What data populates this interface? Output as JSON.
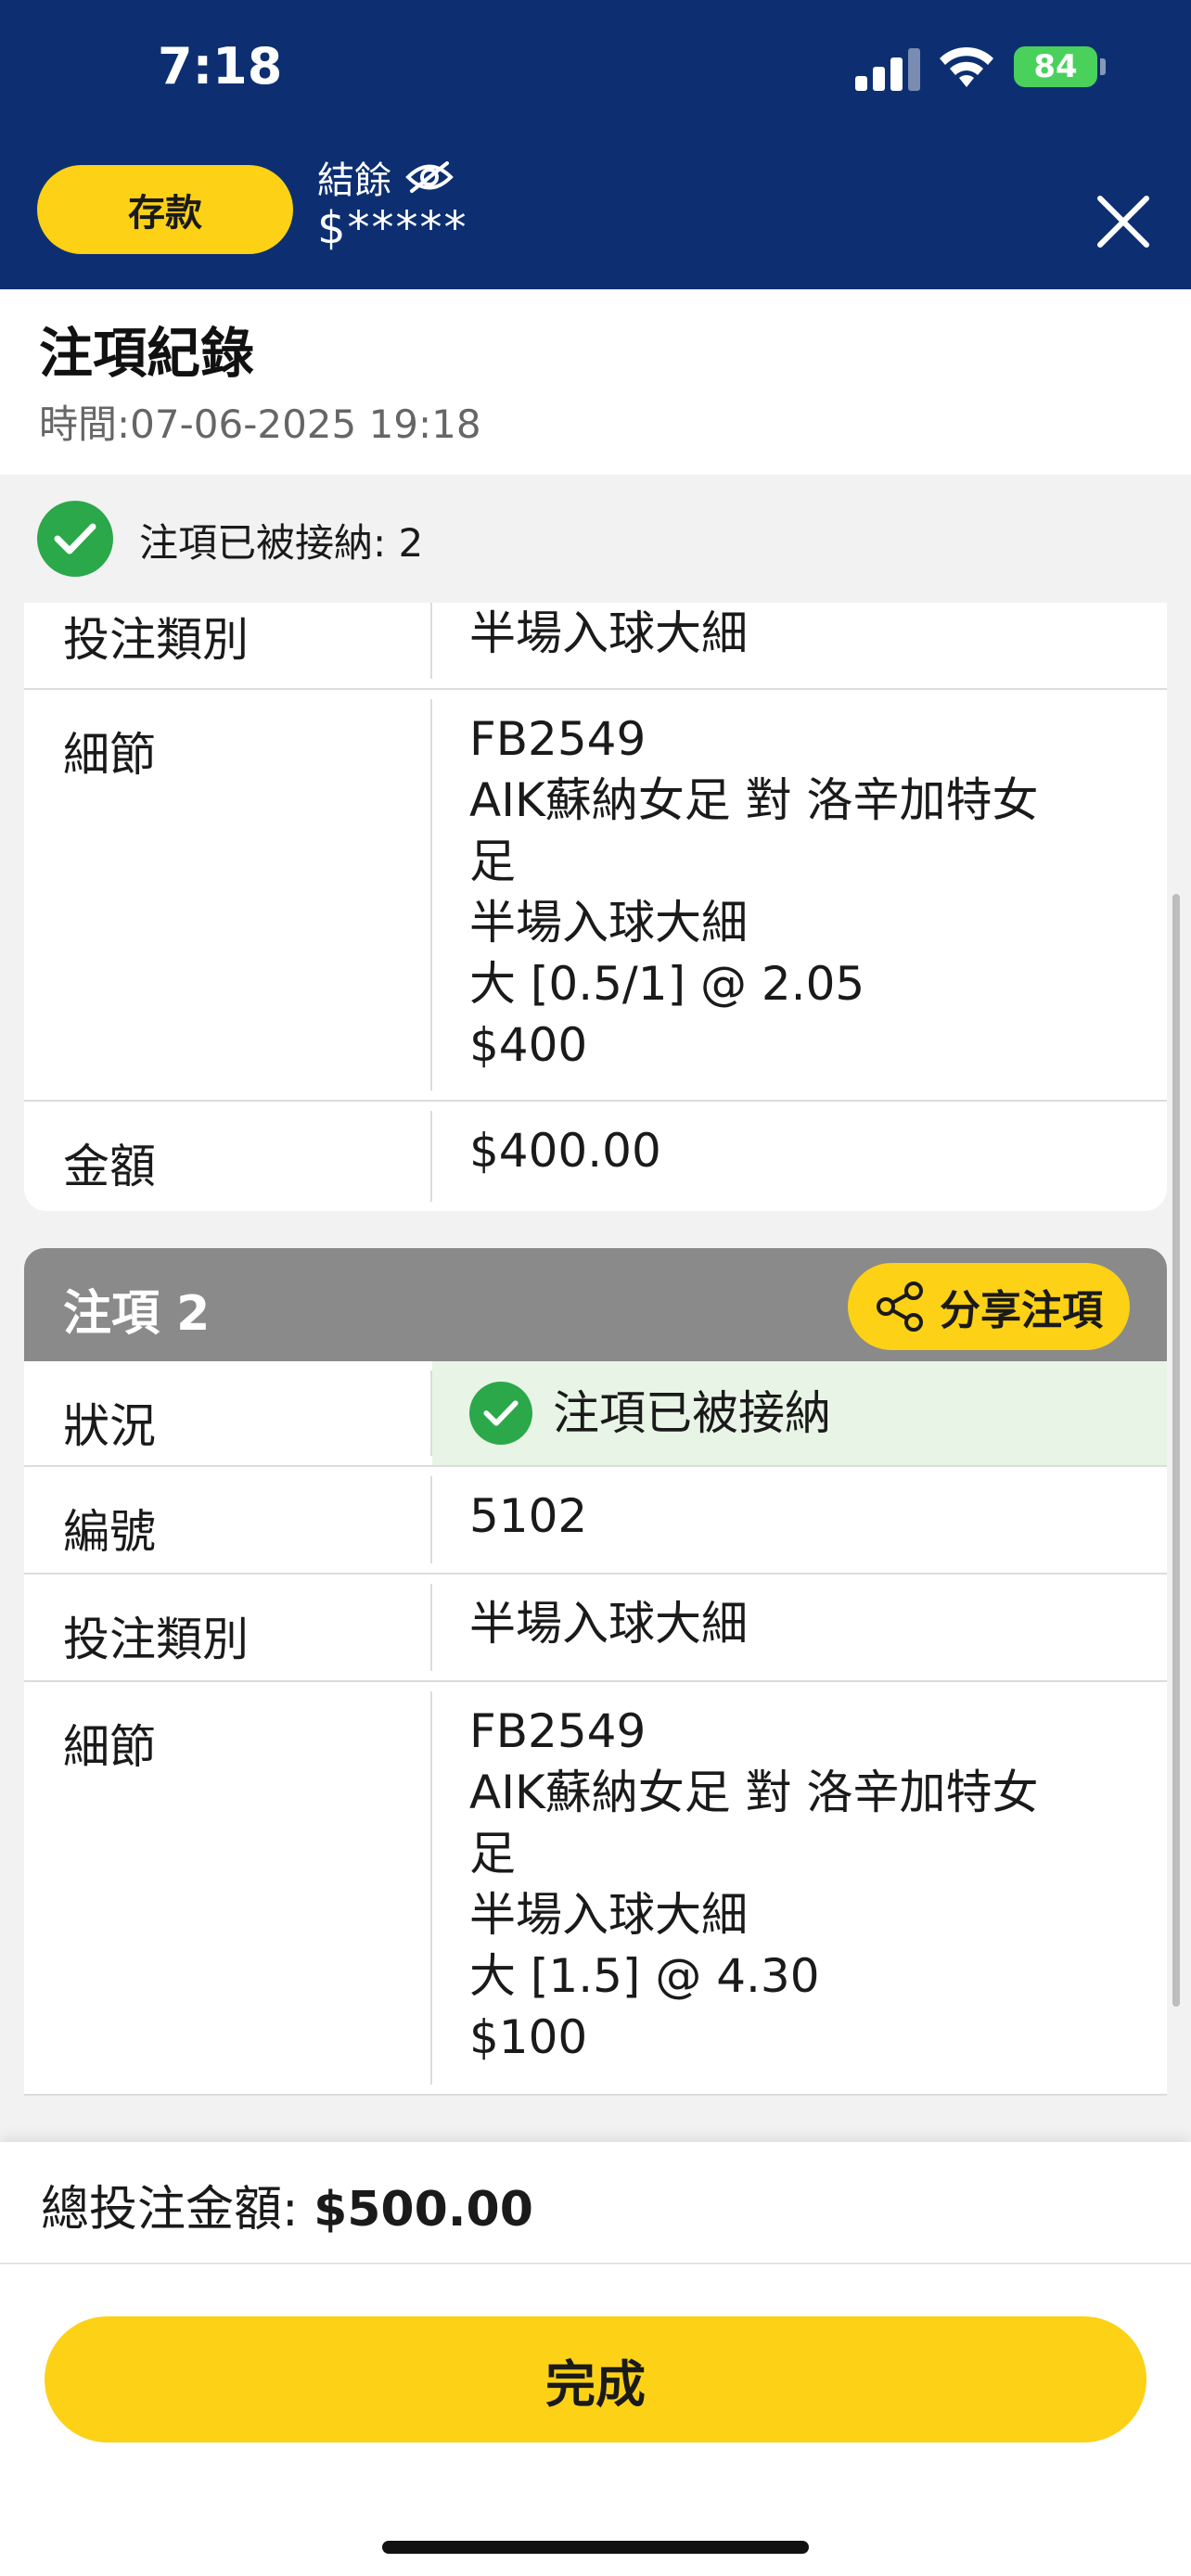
{
  "status_bar": {
    "time": "7:18",
    "battery": "84"
  },
  "header": {
    "deposit_label": "存款",
    "balance_label": "結餘",
    "balance_value": "$*****"
  },
  "page": {
    "title": "注項紀錄",
    "time": "時間:07-06-2025 19:18",
    "accepted_summary": "注項已被接納: 2"
  },
  "bet1": {
    "rows": [
      {
        "label": "投注類別",
        "value": "半場入球大細"
      },
      {
        "label": "細節",
        "value": "FB2549\nAIK蘇納女足 對 洛辛加特女\n足\n半場入球大細\n大 [0.5/1] @ 2.05\n$400"
      },
      {
        "label": "金額",
        "value": "$400.00"
      }
    ]
  },
  "bet2": {
    "title": "注項 2",
    "share_label": "分享注項",
    "status_label": "狀況",
    "status_value": "注項已被接納",
    "rows": [
      {
        "label": "編號",
        "value": "5102"
      },
      {
        "label": "投注類別",
        "value": "半場入球大細"
      },
      {
        "label": "細節",
        "value": "FB2549\nAIK蘇納女足 對 洛辛加特女\n足\n半場入球大細\n大 [1.5] @ 4.30\n$100"
      }
    ]
  },
  "footer": {
    "total_label": "總投注金額:",
    "total_value": "$500.00",
    "done_label": "完成"
  },
  "colors": {
    "navy": "#0d2f72",
    "yellow": "#fcd116",
    "green": "#2ba84a",
    "grey_header": "#8a8a8a"
  }
}
